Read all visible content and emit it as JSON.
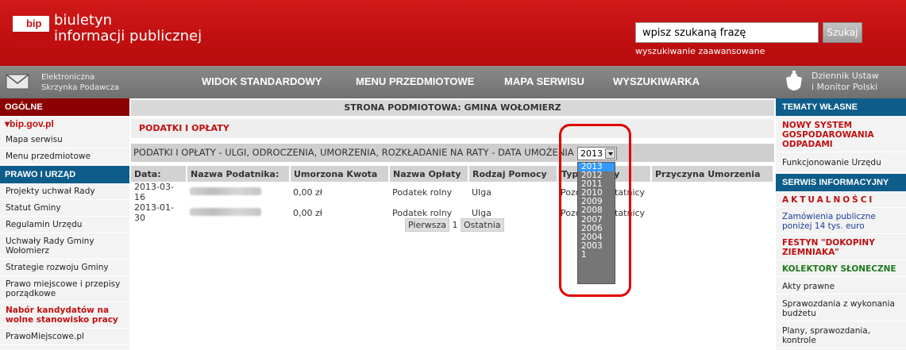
{
  "header": {
    "logo_mark": "bip",
    "logo_line1": "biuletyn",
    "logo_line2": "informacji publicznej",
    "search_value": "wpisz szukaną frazę",
    "search_button": "Szukaj",
    "advanced_search": "wyszukiwanie zaawansowane"
  },
  "navbar": {
    "epuap_line1": "Elektroniczna",
    "epuap_line2": "Skrzynka Podawcza",
    "items": [
      "WIDOK STANDARDOWY",
      "MENU PRZEDMIOTOWE",
      "MAPA SERWISU",
      "WYSZUKIWARKA"
    ],
    "dziennik_line1": "Dziennik Ustaw",
    "dziennik_line2": "i Monitor Polski"
  },
  "left": {
    "ogolne_head": "OGÓLNE",
    "bipgov": "bip.gov.pl",
    "ogolne_items": [
      "Mapa serwisu",
      "Menu przedmiotowe"
    ],
    "prawo_head": "PRAWO I URZĄD",
    "prawo_items": [
      "Projekty uchwał Rady",
      "Statut Gminy",
      "Regulamin Urzędu",
      "Uchwały Rady Gminy Wołomierz",
      "Strategie rozwoju Gminy",
      "Prawo miejscowe i przepisy porządkowe"
    ],
    "nabor": "Nabór kandydatów na wolne stanowisko pracy",
    "prawomiejscowe": "PrawoMiejscowe.pl"
  },
  "main": {
    "subject": "STRONA PODMIOTOWA: GMINA WOŁOMIERZ",
    "section_title": "PODATKI I OPŁATY",
    "filter_label": "PODATKI I OPŁATY - ULGI, ODROCZENIA, UMORZENIA, ROZKŁADANIE NA RATY - DATA UMOŻENIA",
    "selected_year": "2013",
    "columns": [
      "Data:",
      "Nazwa Podatnika:",
      "Umorzona Kwota",
      "Nazwa Opłaty",
      "Rodzaj Pomocy",
      "Typ Pomocy",
      "Przyczyna Umorzenia"
    ],
    "rows": [
      [
        "2013-03-16",
        "",
        "0,00 zł",
        "Podatek rolny",
        "Ulga",
        "Pozostałe ostatnicy",
        ""
      ],
      [
        "2013-01-30",
        "",
        "0,00 zł",
        "Podatek rolny",
        "Ulga",
        "Pozostałe ostatnicy",
        ""
      ]
    ],
    "pager_first": "Pierwsza",
    "pager_current": "1",
    "pager_last": "Ostatnia",
    "years": [
      "2013",
      "2012",
      "2011",
      "2010",
      "2009",
      "2008",
      "2007",
      "2006",
      "2004",
      "2003",
      "1"
    ]
  },
  "right": {
    "tematy_head": "TEMATY WŁASNE",
    "nowy_system": "NOWY SYSTEM GOSPODAROWANIA ODPADAMI",
    "funkcjonowanie": "Funkcjonowanie Urzędu",
    "serwis_head": "SERWIS INFORMACYJNY",
    "aktualnosci": "AKTUALNOŚCI",
    "zamowienia": "Zamówienia publiczne poniżej 14 tys. euro",
    "festyn": "FESTYN \"DOKOPINY ZIEMNIAKA\"",
    "kolektory": "KOLEKTORY SŁONECZNE",
    "akty": "Akty prawne",
    "sprawozdania": "Sprawozdania z wykonania budżetu",
    "plany": "Plany, sprawozdania, kontrole"
  },
  "colors": {
    "brand_red": "#c00f10",
    "nav_grey": "#7a7a7a",
    "right_blue": "#0d5c8a",
    "highlight": "#e00000"
  }
}
